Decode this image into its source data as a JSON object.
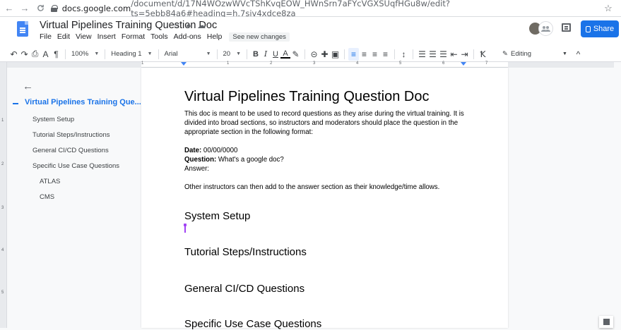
{
  "browser": {
    "back": "←",
    "forward": "→",
    "reload": "C",
    "url_host": "docs.google.com",
    "url_path": "/document/d/17N4WOzwWVcTShKvqEOW_HWnSrn7aFYcVGXSUqfHGu8w/edit?ts=5ebb84a6#heading=h.7siv4xdce8za",
    "bookmark": "☆"
  },
  "doc": {
    "title": "Virtual Pipelines Training Question Doc",
    "star": "☆",
    "move": "♠",
    "cloud": "☁",
    "menu": [
      "File",
      "Edit",
      "View",
      "Insert",
      "Format",
      "Tools",
      "Add-ons",
      "Help"
    ],
    "see_changes": "See new changes",
    "share_label": "Share"
  },
  "toolbar": {
    "undo": "↶",
    "redo": "↷",
    "print": "⎙",
    "spell": "A",
    "paint": "¶",
    "zoom": "100%",
    "style": "Heading 1",
    "font": "Arial",
    "size": "20",
    "bold": "B",
    "italic": "I",
    "underline": "U",
    "text_color": "A",
    "highlight": "✎",
    "link": "⊝",
    "comment": "✚",
    "image": "▣",
    "align_left": "≡",
    "align_center": "≡",
    "align_right": "≡",
    "justify": "≡",
    "line_spacing": "↕",
    "checklist": "☰",
    "bullets": "☰",
    "numbered": "☰",
    "indent_less": "⇤",
    "indent_more": "⇥",
    "clear": "Ꝁ",
    "mode": "Editing",
    "collapse": "^"
  },
  "ruler": {
    "h_numbers": [
      "1",
      "1",
      "2",
      "3",
      "4",
      "5",
      "6",
      "7"
    ],
    "v_numbers": [
      "1",
      "2",
      "3",
      "4",
      "5"
    ]
  },
  "outline": {
    "back": "←",
    "heading": "Virtual Pipelines Training Que...",
    "items": [
      "System Setup",
      "Tutorial Steps/Instructions",
      "General CI/CD Questions",
      "Specific Use Case Questions"
    ],
    "sub_items": [
      "ATLAS",
      "CMS"
    ]
  },
  "body": {
    "title": "Virtual Pipelines Training Question Doc",
    "intro_1": "This doc is meant to be used to record questions as they arise during the virtual training. It is",
    "intro_2": "divided into broad sections, so instructors and moderators should place the question in the",
    "intro_3": "appropriate section in the following format:",
    "date_label": "Date:",
    "date_value": " 00/00/0000",
    "question_label": "Question:",
    "question_value": " What's a google doc?",
    "answer_label": "Answer:",
    "other": "Other instructors can then add to the answer section as their knowledge/time allows.",
    "sections": [
      "System Setup",
      "Tutorial Steps/Instructions",
      "General CI/CD Questions",
      "Specific Use Case Questions"
    ]
  }
}
